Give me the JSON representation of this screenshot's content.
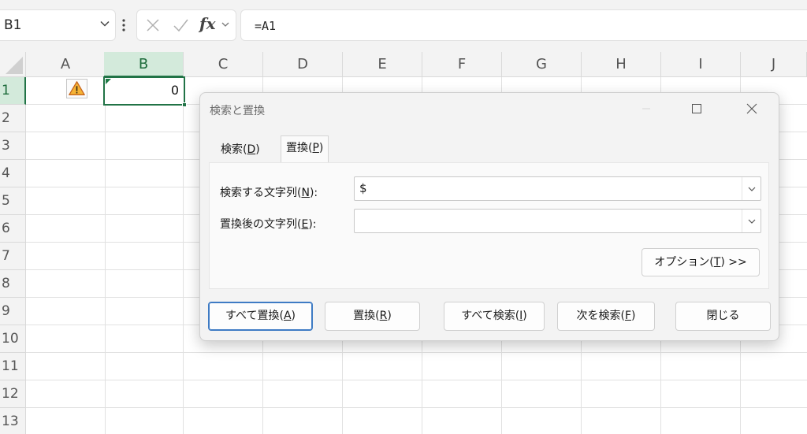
{
  "namebox": {
    "value": "B1"
  },
  "formula_bar": {
    "fx_label": "fx",
    "formula": "=A1"
  },
  "columns": [
    "A",
    "B",
    "C",
    "D",
    "E",
    "F",
    "G",
    "H",
    "I",
    "J"
  ],
  "rows": [
    "1",
    "2",
    "3",
    "4",
    "5",
    "6",
    "7",
    "8",
    "9",
    "10",
    "11",
    "12",
    "13"
  ],
  "selected_cell": {
    "ref": "B1",
    "value": "0"
  },
  "dialog": {
    "title": "検索と置換",
    "tabs": [
      {
        "label": "検索(",
        "key": "D",
        "end": ")"
      },
      {
        "label": "置換(",
        "key": "P",
        "end": ")"
      }
    ],
    "find_label": {
      "text": "検索する文字列(",
      "key": "N",
      "end": "):"
    },
    "find_value": "$",
    "replace_label": {
      "text": "置換後の文字列(",
      "key": "E",
      "end": "):"
    },
    "replace_value": "",
    "options_button": {
      "text": "オプション(",
      "key": "T",
      "end": ") >>"
    },
    "buttons": [
      {
        "text": "すべて置換(",
        "key": "A",
        "end": ")"
      },
      {
        "text": "置換(",
        "key": "R",
        "end": ")"
      },
      {
        "text": "すべて検索(",
        "key": "I",
        "end": ")"
      },
      {
        "text": "次を検索(",
        "key": "F",
        "end": ")"
      },
      {
        "text": "閉じる",
        "key": "",
        "end": ""
      }
    ]
  },
  "colors": {
    "accent": "#217346",
    "selection_header": "#d3eadb",
    "primary_button_border": "#3e7bc4"
  },
  "icons": [
    "chevron-down-icon",
    "more-icon",
    "cancel-icon",
    "enter-icon",
    "warning-icon",
    "minimize-icon",
    "maximize-icon",
    "close-icon"
  ]
}
